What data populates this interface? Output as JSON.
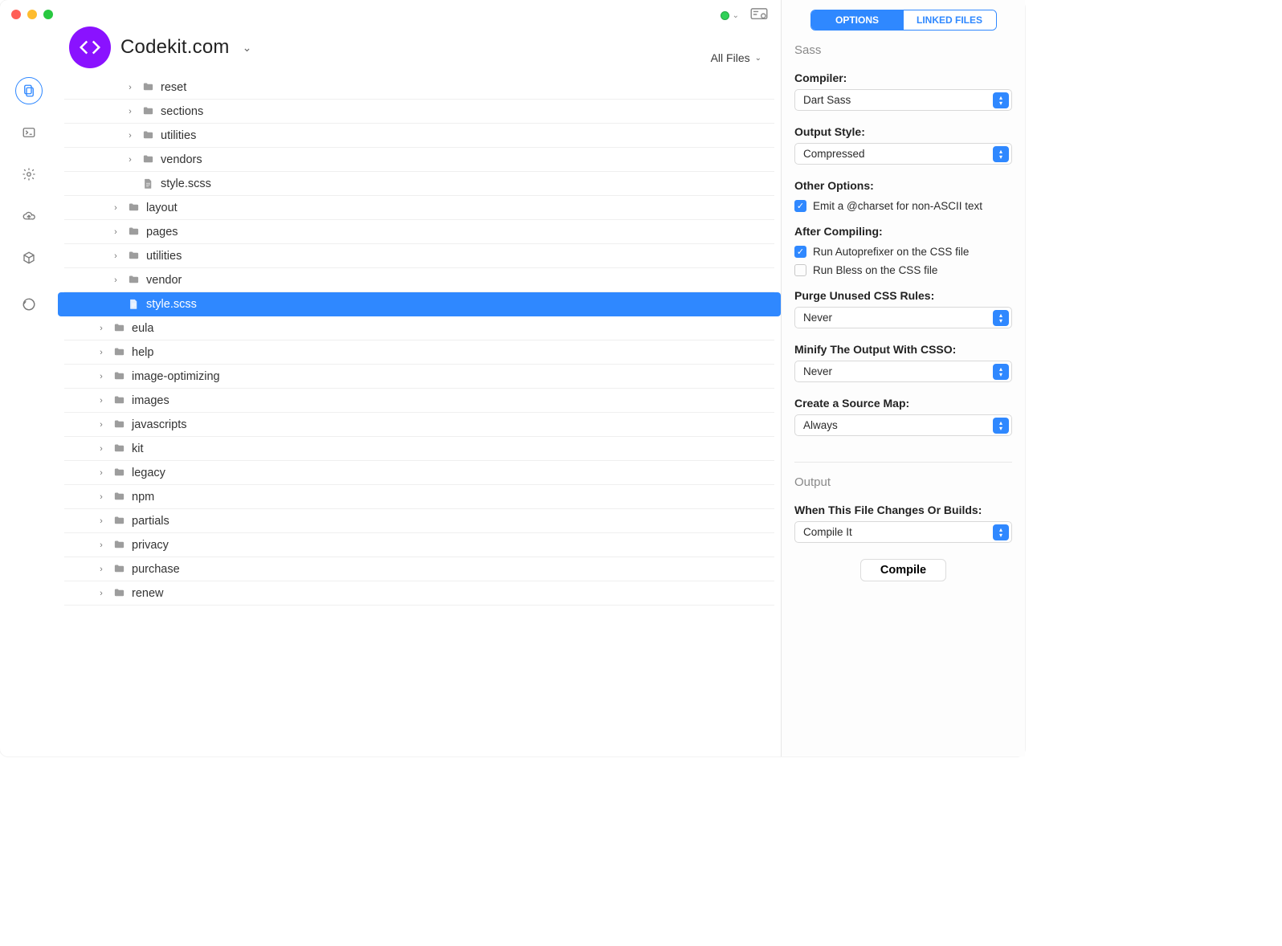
{
  "window": {
    "title": "Codekit.com"
  },
  "header": {
    "status_icon": "green",
    "filter_label": "All Files"
  },
  "rail": {
    "items": [
      "files",
      "terminal",
      "settings",
      "cloud",
      "package",
      "history"
    ],
    "active": "files"
  },
  "tree": [
    {
      "name": "reset",
      "kind": "folder",
      "depth": 2,
      "twisty": ">"
    },
    {
      "name": "sections",
      "kind": "folder",
      "depth": 2,
      "twisty": ">"
    },
    {
      "name": "utilities",
      "kind": "folder",
      "depth": 2,
      "twisty": ">"
    },
    {
      "name": "vendors",
      "kind": "folder",
      "depth": 2,
      "twisty": ">"
    },
    {
      "name": "style.scss",
      "kind": "file",
      "depth": 2,
      "twisty": ""
    },
    {
      "name": "layout",
      "kind": "folder",
      "depth": 1,
      "twisty": ">"
    },
    {
      "name": "pages",
      "kind": "folder",
      "depth": 1,
      "twisty": ">"
    },
    {
      "name": "utilities",
      "kind": "folder",
      "depth": 1,
      "twisty": ">"
    },
    {
      "name": "vendor",
      "kind": "folder",
      "depth": 1,
      "twisty": ">"
    },
    {
      "name": "style.scss",
      "kind": "file",
      "depth": 1,
      "twisty": "",
      "selected": true
    },
    {
      "name": "eula",
      "kind": "folder",
      "depth": 0,
      "twisty": ">"
    },
    {
      "name": "help",
      "kind": "folder",
      "depth": 0,
      "twisty": ">"
    },
    {
      "name": "image-optimizing",
      "kind": "folder",
      "depth": 0,
      "twisty": ">"
    },
    {
      "name": "images",
      "kind": "folder",
      "depth": 0,
      "twisty": ">"
    },
    {
      "name": "javascripts",
      "kind": "folder",
      "depth": 0,
      "twisty": ">"
    },
    {
      "name": "kit",
      "kind": "folder",
      "depth": 0,
      "twisty": ">"
    },
    {
      "name": "legacy",
      "kind": "folder",
      "depth": 0,
      "twisty": ">"
    },
    {
      "name": "npm",
      "kind": "folder",
      "depth": 0,
      "twisty": ">"
    },
    {
      "name": "partials",
      "kind": "folder",
      "depth": 0,
      "twisty": ">"
    },
    {
      "name": "privacy",
      "kind": "folder",
      "depth": 0,
      "twisty": ">"
    },
    {
      "name": "purchase",
      "kind": "folder",
      "depth": 0,
      "twisty": ">"
    },
    {
      "name": "renew",
      "kind": "folder",
      "depth": 0,
      "twisty": ">"
    }
  ],
  "inspector": {
    "tabs": {
      "options": "OPTIONS",
      "linked": "LINKED FILES",
      "active": "options"
    },
    "section1_title": "Sass",
    "compiler": {
      "label": "Compiler:",
      "value": "Dart Sass"
    },
    "output_style": {
      "label": "Output Style:",
      "value": "Compressed"
    },
    "other_options_label": "Other Options:",
    "opt_charset": {
      "label": "Emit a @charset for non-ASCII text",
      "checked": true
    },
    "after_compiling_label": "After Compiling:",
    "opt_autoprefixer": {
      "label": "Run Autoprefixer on the CSS file",
      "checked": true
    },
    "opt_bless": {
      "label": "Run Bless on the CSS file",
      "checked": false
    },
    "purge": {
      "label": "Purge Unused CSS Rules:",
      "value": "Never"
    },
    "minify": {
      "label": "Minify The Output With CSSO:",
      "value": "Never"
    },
    "sourcemap": {
      "label": "Create a Source Map:",
      "value": "Always"
    },
    "section2_title": "Output",
    "when_changes": {
      "label": "When This File Changes Or Builds:",
      "value": "Compile It"
    },
    "compile_button": "Compile"
  }
}
